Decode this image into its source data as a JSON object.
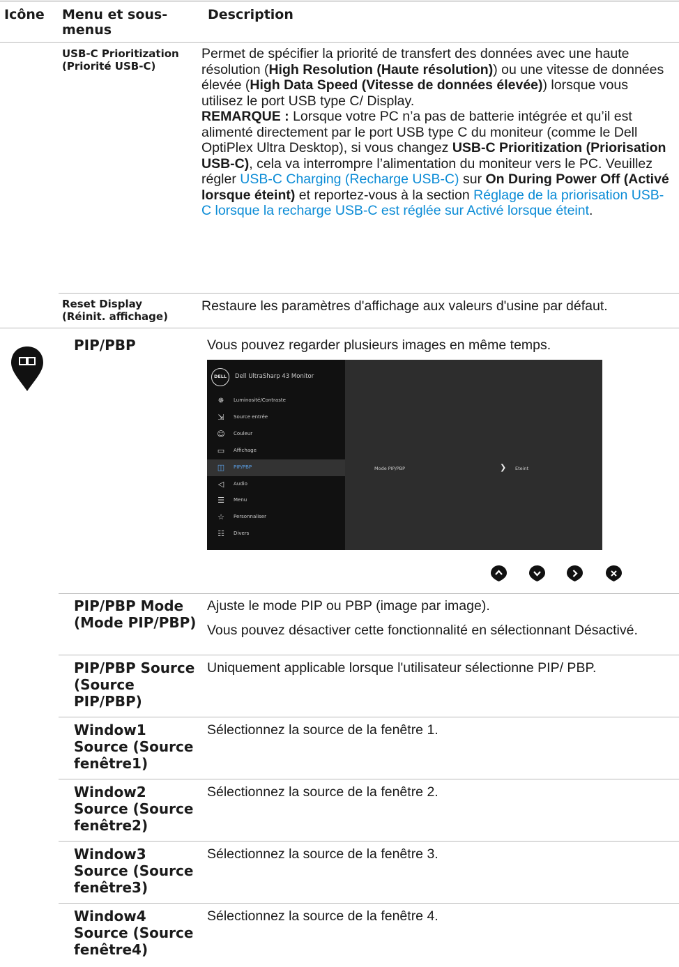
{
  "header": {
    "col_icon": "Icône",
    "col_menu": "Menu et sous-menus",
    "col_desc": "Description"
  },
  "usbc": {
    "name_line1": "USB-C Prioritization",
    "name_line2": "(Priorité USB-C)",
    "d_p1a": "Permet de spécifier la priorité de transfert des données avec une haute résolution (",
    "d_p1b": "High Resolution (Haute résolution)",
    "d_p1c": ") ou une vitesse de données élevée (",
    "d_p1d": "High Data Speed (Vitesse de données élevée)",
    "d_p1e": ") lorsque vous utilisez le port USB type C/ Display.",
    "d_note_label": "REMARQUE :",
    "d_note_a": " Lorsque votre PC n’a pas de batterie intégrée et qu’il est alimenté directement par le port USB type C du moniteur (comme le Dell OptiPlex Ultra Desktop), si vous changez ",
    "d_note_b": "USB-C Prioritization (Priorisation USB-C)",
    "d_note_c": ", cela va interrompre l’alimentation du moniteur vers le PC. Veuillez régler ",
    "d_note_link1": "USB-C Charging (Recharge USB-C)",
    "d_note_d": " sur ",
    "d_note_e": "On During Power Off (Activé lorsque éteint)",
    "d_note_f": " et reportez-vous à la section ",
    "d_note_link2": "Réglage de la priorisation USB-C lorsque la recharge USB-C est réglée sur Activé lorsque éteint",
    "d_note_g": "."
  },
  "reset": {
    "name_line1": "Reset Display",
    "name_line2": "(Réinit. affichage)",
    "desc": "Restaure les paramètres d'affichage aux valeurs d'usine par défaut."
  },
  "pip": {
    "name": "PIP/PBP",
    "desc": "Vous pouvez regarder plusieurs images en même temps."
  },
  "osd": {
    "logo": "DELL",
    "title": "Dell UltraSharp 43 Monitor",
    "items": [
      {
        "icon": "brightness-icon",
        "label": "Luminosité/Contraste"
      },
      {
        "icon": "input-source-icon",
        "label": "Source entrée"
      },
      {
        "icon": "color-icon",
        "label": "Couleur"
      },
      {
        "icon": "display-icon",
        "label": "Affichage"
      },
      {
        "icon": "pip-icon",
        "label": "PIP/PBP"
      },
      {
        "icon": "audio-icon",
        "label": "Audio"
      },
      {
        "icon": "menu-icon",
        "label": "Menu"
      },
      {
        "icon": "star-icon",
        "label": "Personnaliser"
      },
      {
        "icon": "others-icon",
        "label": "Divers"
      }
    ],
    "active_index": 4,
    "mode_label": "Mode PIP/PBP",
    "mode_value": "Eteint"
  },
  "nav_buttons": [
    "up-icon",
    "down-icon",
    "right-icon",
    "close-icon"
  ],
  "accent_color": "#0a8bd6",
  "rows": [
    {
      "name": "PIP/PBP Mode (Mode PIP/PBP)",
      "desc1": "Ajuste le mode PIP ou PBP (image par image).",
      "desc2": "Vous pouvez désactiver cette fonctionnalité en sélectionnant Désactivé."
    },
    {
      "name": "PIP/PBP Source (Source PIP/PBP)",
      "desc1": "Uniquement applicable lorsque l'utilisateur sélectionne PIP/ PBP."
    },
    {
      "name": "Window1 Source (Source fenêtre1)",
      "desc1": "Sélectionnez la source de la fenêtre 1."
    },
    {
      "name": "Window2 Source (Source fenêtre2)",
      "desc1": "Sélectionnez la source de la fenêtre 2."
    },
    {
      "name": "Window3 Source (Source fenêtre3)",
      "desc1": "Sélectionnez la source de la fenêtre 3."
    },
    {
      "name": "Window4 Source (Source fenêtre4)",
      "desc1": "Sélectionnez la source de la fenêtre 4."
    }
  ]
}
